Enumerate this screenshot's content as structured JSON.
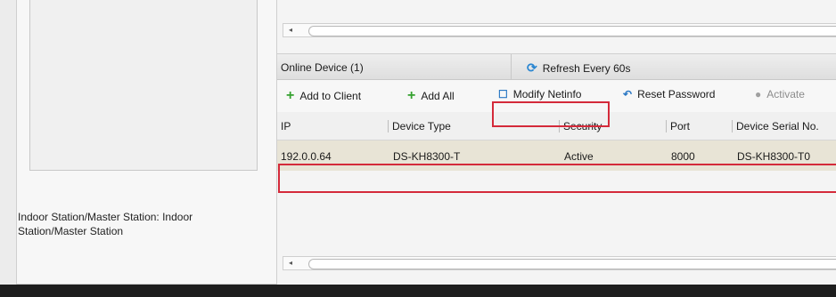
{
  "left_panel": {
    "description": "Indoor Station/Master Station: Indoor Station/Master Station"
  },
  "scrollbar": {
    "arrow": "◂"
  },
  "tab": {
    "title": "Online Device (1)",
    "refresh_label": "Refresh Every 60s",
    "refresh_icon": "refresh-icon"
  },
  "toolbar": {
    "add_to_client": "Add to Client",
    "add_all": "Add All",
    "modify_netinfo": "Modify Netinfo",
    "reset_password": "Reset Password",
    "activate": "Activate"
  },
  "table": {
    "headers": [
      "IP",
      "Device Type",
      "Security",
      "Port",
      "Device Serial No."
    ],
    "rows": [
      [
        "192.0.0.64",
        "DS-KH8300-T",
        "Active",
        "8000",
        "DS-KH8300-T0"
      ]
    ]
  },
  "colors": {
    "highlight": "#d42a3a",
    "add_green": "#35a12f",
    "selected_row": "#e8e4d6"
  }
}
